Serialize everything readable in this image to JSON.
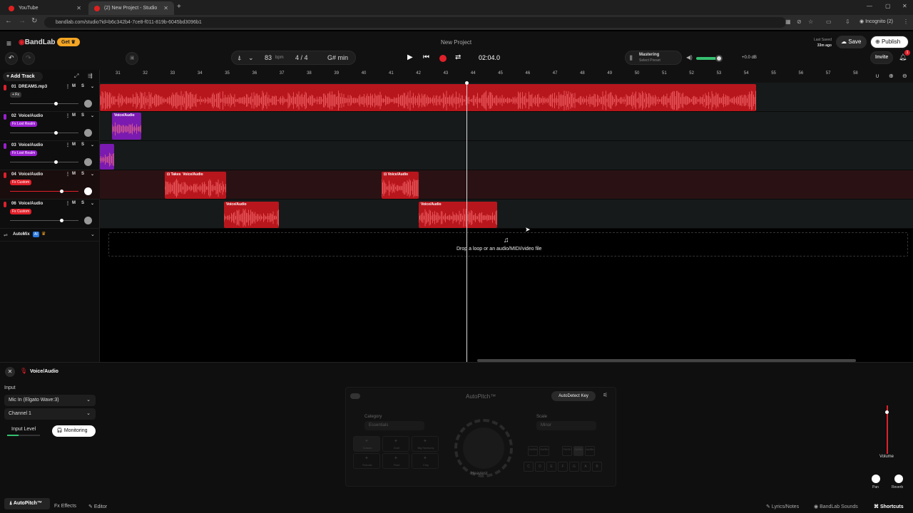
{
  "browser": {
    "tabs": [
      {
        "title": "YouTube"
      },
      {
        "title": "(2) New Project - Studio"
      }
    ],
    "url": "bandlab.com/studio?id=b6c342b4-7ce8-f011-819b-6045bd3096b1",
    "incognito_label": "Incognito (2)"
  },
  "header": {
    "logo": "BandLab",
    "get_label": "Get",
    "project_title": "New Project",
    "last_saved_label": "Last Saved",
    "last_saved_time": "33m ago",
    "save_label": "Save",
    "publish_label": "Publish",
    "bpm": "83",
    "bpm_unit": "bpm",
    "time_sig": "4 / 4",
    "key": "G# min",
    "timecode": "02:04.0",
    "mastering_label": "Mastering",
    "mastering_preset": "Select Preset",
    "volume_db": "+0.0 dB",
    "invite_label": "Invite",
    "notif_count": "1"
  },
  "sidebar": {
    "add_track_label": "Add Track",
    "automix_label": "AutoMix",
    "automix_badge": "AI"
  },
  "tracks": [
    {
      "num": "01",
      "name": "DREAMS.mp3",
      "badge": "+ Fx",
      "color": "#e0202a"
    },
    {
      "num": "02",
      "name": "Voice/Audio",
      "badge": "Fx Lost Realm",
      "color": "#9b1fd0"
    },
    {
      "num": "03",
      "name": "Voice/Audio",
      "badge": "Fx Lost Realm",
      "color": "#9b1fd0"
    },
    {
      "num": "04",
      "name": "Voice/Audio",
      "badge": "Fx Custom",
      "color": "#e0202a"
    },
    {
      "num": "06",
      "name": "Voice/Audio",
      "badge": "Fx Custom",
      "color": "#e0202a"
    }
  ],
  "ruler": {
    "bars": [
      "31",
      "32",
      "33",
      "34",
      "35",
      "36",
      "37",
      "38",
      "39",
      "40",
      "41",
      "42",
      "43",
      "44",
      "45",
      "46",
      "47",
      "48",
      "49",
      "50",
      "51",
      "52",
      "53",
      "54",
      "55",
      "56",
      "57",
      "58"
    ]
  },
  "clips": {
    "label": "Voice/Audio",
    "takes_label": "Takes"
  },
  "dropzone": {
    "text": "Drop a loop or an audio/MIDI/video file"
  },
  "bottom": {
    "track_name": "Voice/Audio",
    "input_label": "Input",
    "input_device": "Mic In (Elgato Wave:3)",
    "channel": "Channel 1",
    "input_level_label": "Input Level",
    "monitoring_label": "Monitoring",
    "autopitch_title": "AutoPitch™",
    "autodetect_label": "AutoDetect Key",
    "category_label": "Category",
    "category_value": "Essentials",
    "scale_label": "Scale",
    "scale_value": "Minor",
    "effects": [
      "Classic",
      "Duet",
      "Big Harmony",
      "Robotic",
      "Fluid",
      "Chip"
    ],
    "knob_label": "Heaviest",
    "keys_sharp": [
      "C#/Db",
      "D#/Eb",
      "F#/Gb",
      "G#/Ab",
      "A#/Bb"
    ],
    "keys_nat": [
      "C",
      "D",
      "E",
      "F",
      "G",
      "A",
      "B"
    ],
    "volume_label": "Volume",
    "pan_label": "Pan",
    "reverb_label": "Reverb",
    "tabs": {
      "autopitch": "AutoPitch™",
      "effects": "Effects",
      "editor": "Editor",
      "lyrics": "Lyrics/Notes",
      "sounds": "BandLab Sounds",
      "shortcuts": "Shortcuts"
    }
  },
  "colors": {
    "accent_red": "#e0202a",
    "accent_purple": "#9b1fd0",
    "get_badge": "#f5a623"
  }
}
